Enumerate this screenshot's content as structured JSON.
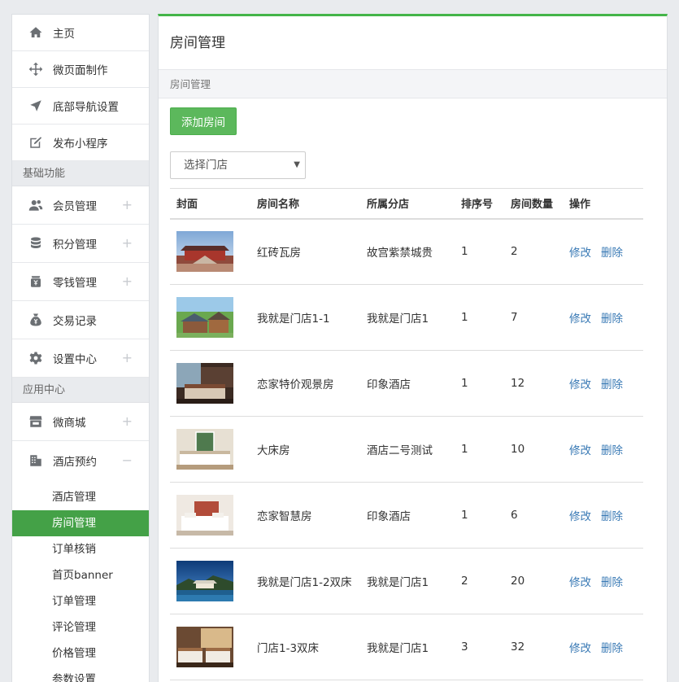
{
  "sidebar": {
    "top_items": [
      {
        "label": "主页",
        "icon": "home-icon"
      },
      {
        "label": "微页面制作",
        "icon": "move-icon"
      },
      {
        "label": "底部导航设置",
        "icon": "navigation-arrow-icon"
      },
      {
        "label": "发布小程序",
        "icon": "edit-icon"
      }
    ],
    "section_basic": "基础功能",
    "basic_items": [
      {
        "label": "会员管理",
        "icon": "users-icon",
        "expand": "+"
      },
      {
        "label": "积分管理",
        "icon": "database-icon",
        "expand": "+"
      },
      {
        "label": "零钱管理",
        "icon": "wallet-icon",
        "expand": "+"
      },
      {
        "label": "交易记录",
        "icon": "money-bag-icon",
        "expand": ""
      },
      {
        "label": "设置中心",
        "icon": "gear-icon",
        "expand": "+"
      }
    ],
    "section_apps": "应用中心",
    "app_items": [
      {
        "label": "微商城",
        "icon": "store-icon",
        "expand": "+"
      },
      {
        "label": "酒店预约",
        "icon": "building-icon",
        "expand": "−"
      }
    ],
    "sub_items": [
      {
        "label": "酒店管理",
        "active": false
      },
      {
        "label": "房间管理",
        "active": true
      },
      {
        "label": "订单核销",
        "active": false
      },
      {
        "label": "首页banner",
        "active": false
      },
      {
        "label": "订单管理",
        "active": false
      },
      {
        "label": "评论管理",
        "active": false
      },
      {
        "label": "价格管理",
        "active": false
      },
      {
        "label": "参数设置",
        "active": false
      }
    ]
  },
  "main": {
    "title": "房间管理",
    "breadcrumb": "房间管理",
    "add_button": "添加房间",
    "store_select": "选择门店",
    "table": {
      "headers": [
        "封面",
        "房间名称",
        "所属分店",
        "排序号",
        "房间数量",
        "操作"
      ],
      "edit_label": "修改",
      "delete_label": "删除",
      "rows": [
        {
          "thumb": "palace",
          "name": "红砖瓦房",
          "store": "故宫紫禁城贵",
          "sort": "1",
          "count": "2"
        },
        {
          "thumb": "cabin",
          "name": "我就是门店1-1",
          "store": "我就是门店1",
          "sort": "1",
          "count": "7"
        },
        {
          "thumb": "hotel-room-dark",
          "name": "恋家特价观景房",
          "store": "印象酒店",
          "sort": "1",
          "count": "12"
        },
        {
          "thumb": "bright-bedroom",
          "name": "大床房",
          "store": "酒店二号测试",
          "sort": "1",
          "count": "10"
        },
        {
          "thumb": "white-bedroom",
          "name": "恋家智慧房",
          "store": "印象酒店",
          "sort": "1",
          "count": "6"
        },
        {
          "thumb": "lakeside-pavilion",
          "name": "我就是门店1-2双床",
          "store": "我就是门店1",
          "sort": "2",
          "count": "20"
        },
        {
          "thumb": "twin-room",
          "name": "门店1-3双床",
          "store": "我就是门店1",
          "sort": "3",
          "count": "32"
        }
      ]
    }
  },
  "colors": {
    "accent_green": "#44b549",
    "active_green": "#44a147",
    "link_blue": "#3a7ab5"
  }
}
